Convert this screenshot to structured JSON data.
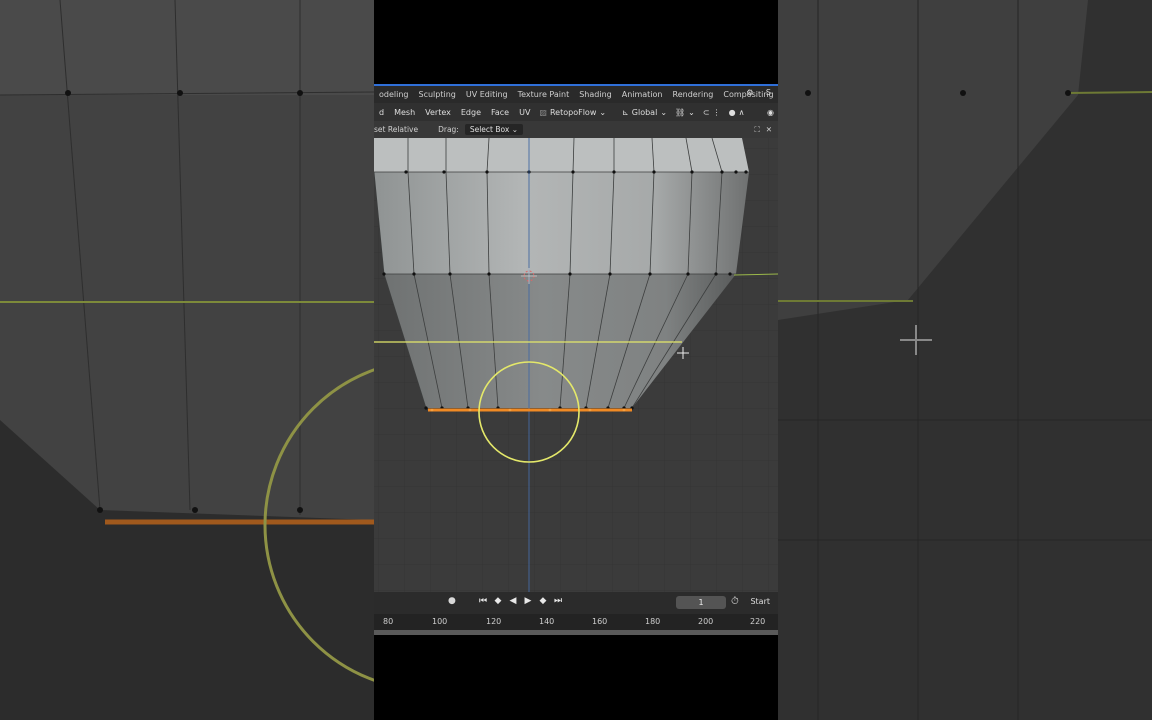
{
  "workspace_tabs": [
    "odeling",
    "Sculpting",
    "UV Editing",
    "Texture Paint",
    "Shading",
    "Animation",
    "Rendering",
    "Compositing"
  ],
  "workspace_right_label": "S",
  "menu": {
    "items": [
      "d",
      "Mesh",
      "Vertex",
      "Edge",
      "Face",
      "UV"
    ],
    "addon": "RetopoFlow",
    "transform_orientation": "Global"
  },
  "tool_options": {
    "offset_label": "set Relative",
    "drag_label": "Drag:",
    "drag_value": "Select Box"
  },
  "timeline": {
    "current_frame": "1",
    "start_label": "Start"
  },
  "ruler_ticks": [
    "80",
    "100",
    "120",
    "140",
    "160",
    "180",
    "200",
    "220"
  ],
  "colors": {
    "accent": "#2f6fd8",
    "selected_edge": "#f08a24",
    "brush_circle": "#e4e86a",
    "axis_y": "#4a7fd0",
    "axis_x": "#9bb84a"
  }
}
